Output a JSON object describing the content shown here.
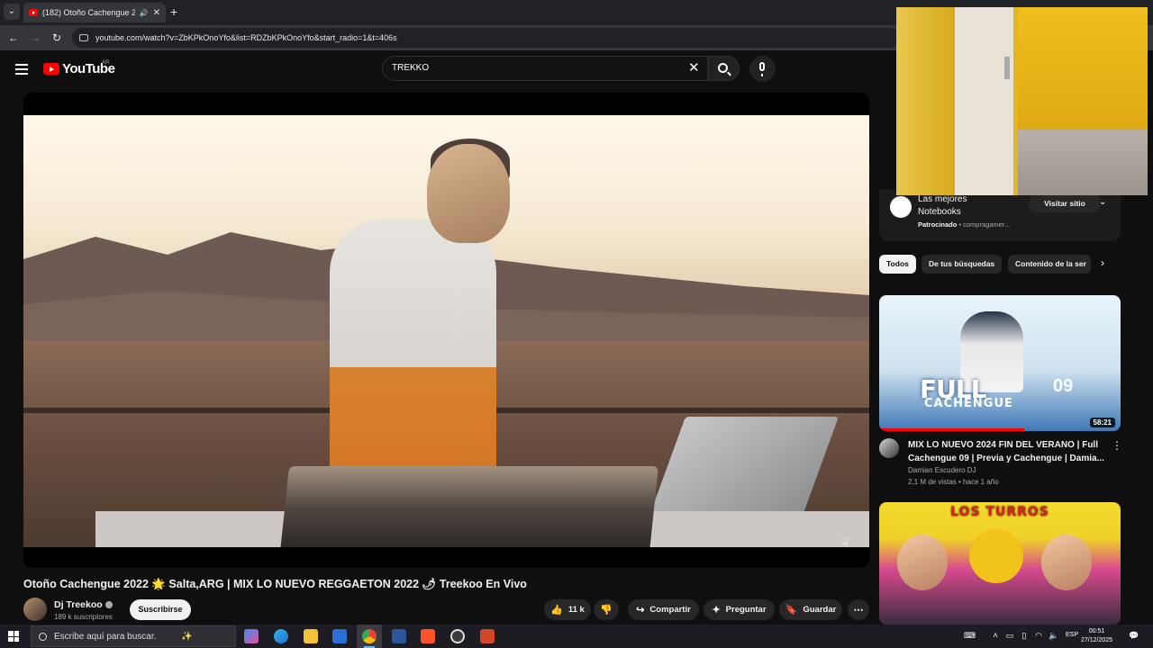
{
  "browser": {
    "tab_title": "(182) Otoño Cachengue 20",
    "new_tab": "+",
    "url": "youtube.com/watch?v=ZbKPkOnoYfo&list=RDZbKPkOnoYfo&start_radio=1&t=406s"
  },
  "header": {
    "logo_text": "YouTube",
    "country": "AR",
    "search_value": "TREKKO"
  },
  "video": {
    "title": "Otoño Cachengue 2022 🌟 Salta,ARG | MIX LO NUEVO REGGAETON 2022 🌶 Treekoo En Vivo",
    "channel": "Dj Treekoo",
    "subscribers": "189 k suscriptores",
    "subscribe_label": "Suscribirse",
    "likes": "11 k",
    "share_label": "Compartir",
    "ask_label": "Preguntar",
    "save_label": "Guardar"
  },
  "ad": {
    "title": "Las mejores Notebooks",
    "sponsored": "Patrocinado",
    "domain": "compragamer...",
    "visit_label": "Visitar sitio"
  },
  "chips": [
    "Todos",
    "De tus búsquedas",
    "Contenido de la ser"
  ],
  "recommendations": [
    {
      "thumb_text": "FULL",
      "thumb_sub": "CACHENGUE",
      "thumb_num": "09",
      "duration": "58:21",
      "title": "MIX LO NUEVO 2024 FIN DEL VERANO | Full Cachengue 09 | Previa y Cachengue | Damia...",
      "channel": "Damian Escudero DJ",
      "meta": "2,1 M de vistas • hace 1 año",
      "watched_fraction": 0.6
    },
    {
      "thumb_text": "LOS TURROS"
    }
  ],
  "taskbar": {
    "search_placeholder": "Escribe aquí para buscar.",
    "lang": "ESP",
    "time": "00:51",
    "date": "27/12/2025"
  },
  "colors": {
    "youtube_red": "#ff0000",
    "background": "#0f0f0f",
    "chip_bg": "#272727"
  }
}
